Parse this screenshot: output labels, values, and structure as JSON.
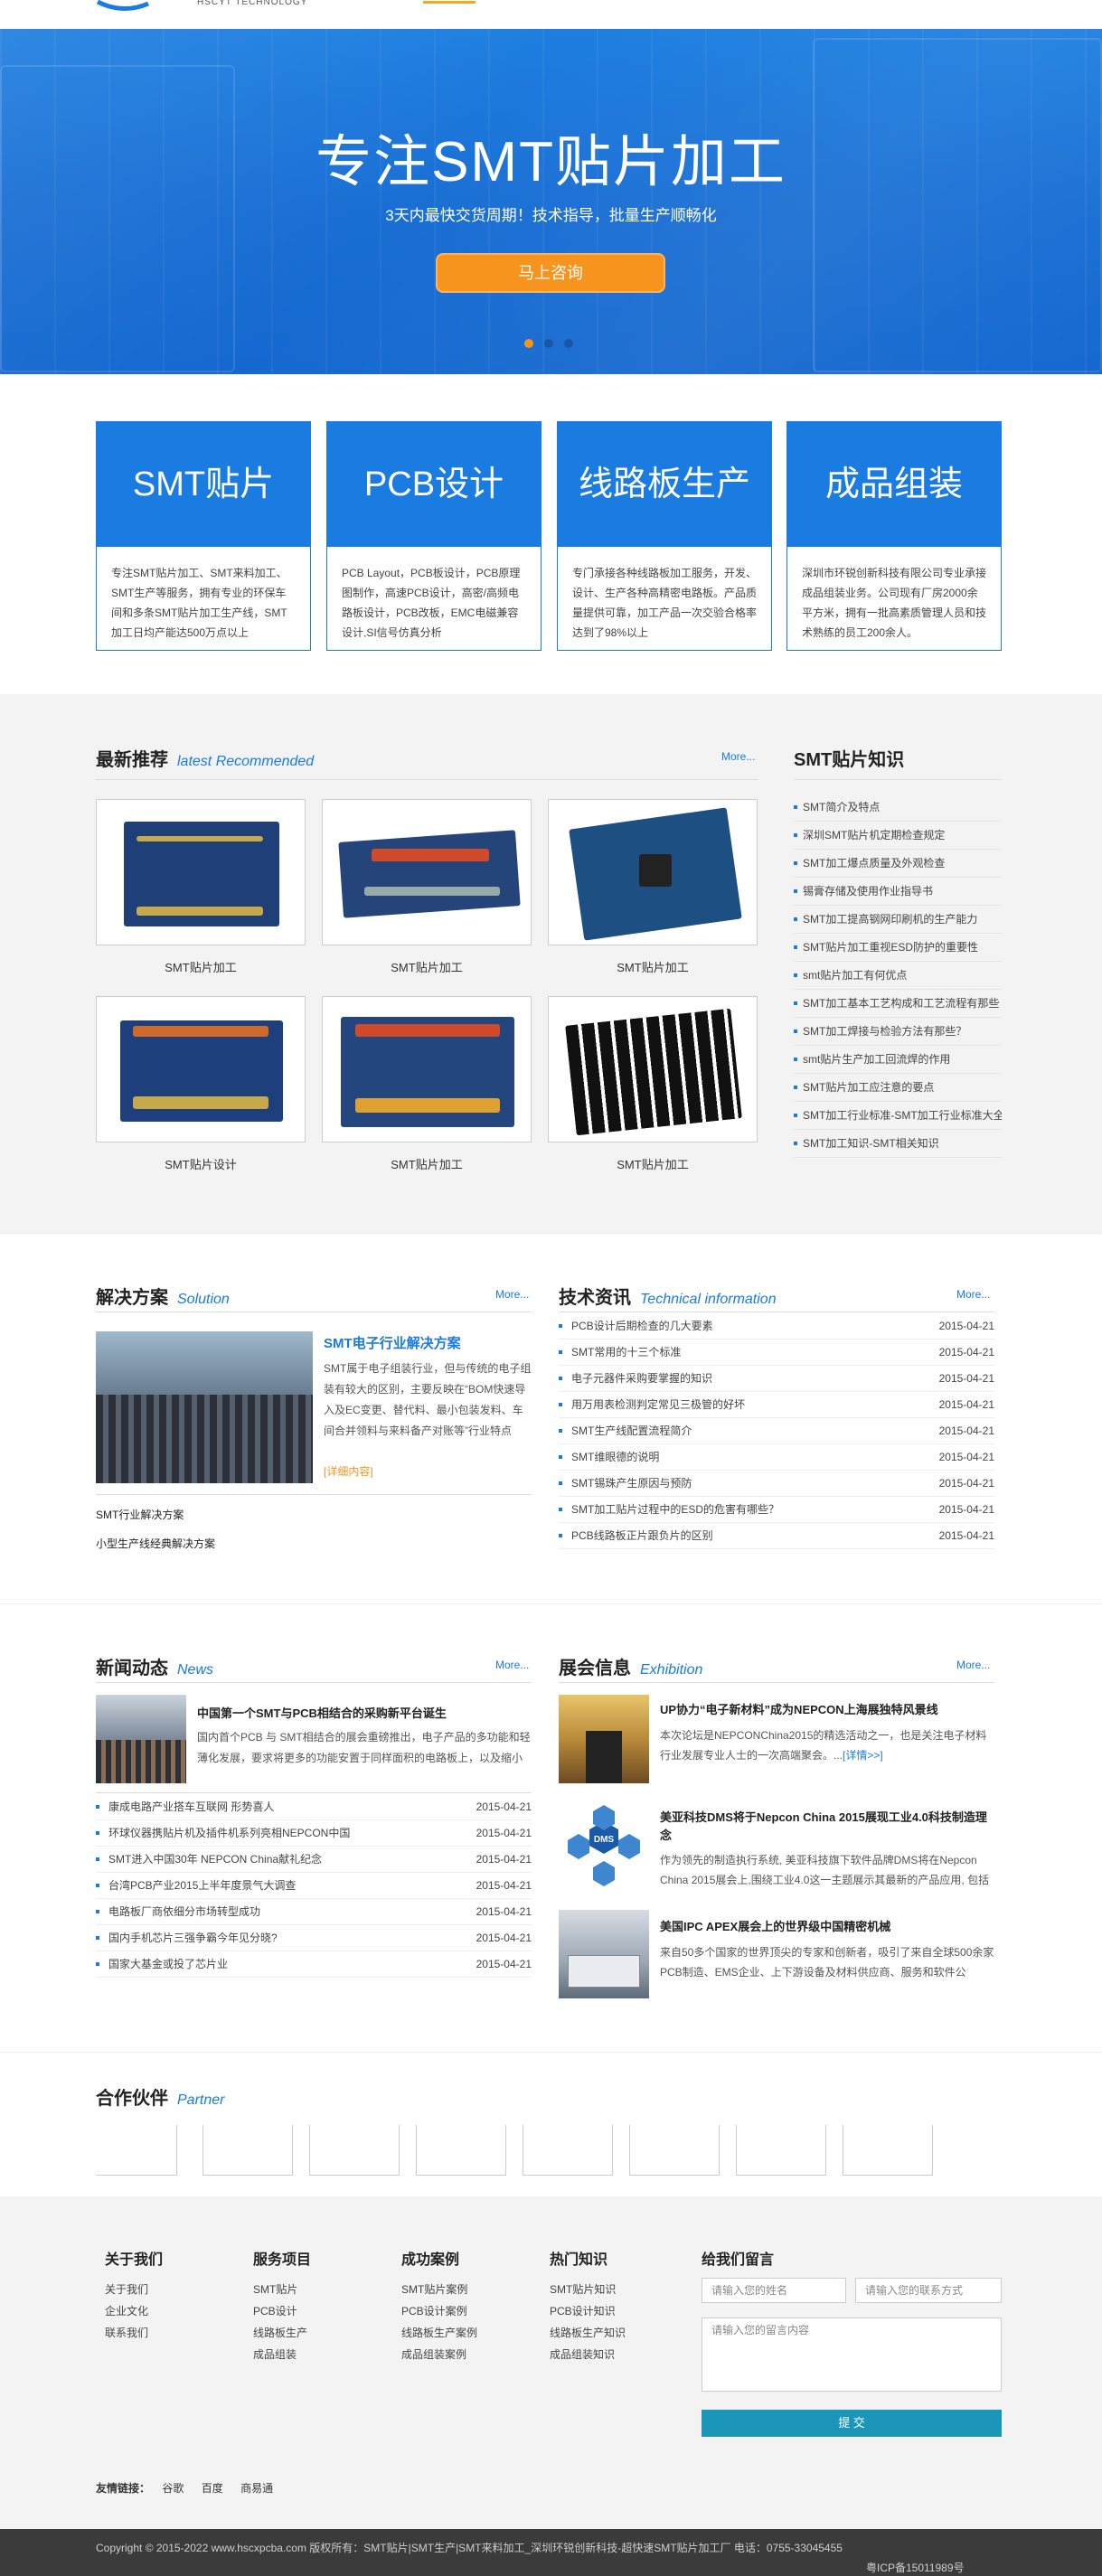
{
  "header": {
    "logo_text": "HSCYT TECHNOLOGY"
  },
  "hero": {
    "title": "专注SMT贴片加工",
    "subtitle": "3天内最快交货周期！技术指导，批量生产顺畅化",
    "cta_label": "马上咨询",
    "slide_count": 3,
    "active_slide": 1
  },
  "services": [
    {
      "title": "SMT贴片",
      "desc": "专注SMT贴片加工、SMT来料加工、SMT生产等服务，拥有专业的环保车间和多条SMT贴片加工生产线，SMT加工日均产能达500万点以上"
    },
    {
      "title": "PCB设计",
      "desc": "PCB Layout，PCB板设计，PCB原理图制作，高速PCB设计，高密/高频电路板设计，PCB改板，EMC电磁兼容设计,SI信号仿真分析"
    },
    {
      "title": "线路板生产",
      "desc": "专门承接各种线路板加工服务，开发、设计、生产各种高精密电路板。产品质量提供可靠，加工产品一次交验合格率达到了98%以上"
    },
    {
      "title": "成品组装",
      "desc": "深圳市环锐创新科技有限公司专业承接成品组装业务。公司现有厂房2000余平方米，拥有一批高素质管理人员和技术熟练的员工200余人。"
    }
  ],
  "recommend": {
    "title": "最新推荐",
    "title_en": "latest Recommended",
    "more": "More...",
    "products": [
      {
        "caption": "SMT贴片加工"
      },
      {
        "caption": "SMT贴片加工"
      },
      {
        "caption": "SMT贴片加工"
      },
      {
        "caption": "SMT贴片设计"
      },
      {
        "caption": "SMT贴片加工"
      },
      {
        "caption": "SMT贴片加工"
      }
    ]
  },
  "knowledge": {
    "title": "SMT贴片知识",
    "items": [
      "SMT简介及特点",
      "深圳SMT贴片机定期检查规定",
      "SMT加工爆点质量及外观检查",
      "锡膏存储及使用作业指导书",
      "SMT加工提高钢网印刷机的生产能力",
      "SMT贴片加工重视ESD防护的重要性",
      "smt贴片加工有何优点",
      "SMT加工基本工艺构成和工艺流程有那些",
      "SMT加工焊接与检验方法有那些？",
      "smt贴片生产加工回流焊的作用",
      "SMT贴片加工应注意的要点",
      "SMT加工行业标准-SMT加工行业标准大全",
      "SMT加工知识-SMT相关知识"
    ]
  },
  "solution": {
    "title": "解决方案",
    "title_en": "Solution",
    "more": "More...",
    "feature_title": "SMT电子行业解决方案",
    "feature_desc": "SMT属于电子组装行业，但与传统的电子组装有较大的区别，主要反映在“BOM快速导入及EC变更、替代料、最小包装发料、车间合并领料与来料备产对账等”行业特点",
    "detail_link": "[详细内容]",
    "links": [
      "SMT行业解决方案",
      "小型生产线经典解决方案"
    ]
  },
  "tech": {
    "title": "技术资讯",
    "title_en": "Technical information",
    "more": "More...",
    "items": [
      {
        "text": "PCB设计后期检查的几大要素",
        "date": "2015-04-21"
      },
      {
        "text": "SMT常用的十三个标准",
        "date": "2015-04-21"
      },
      {
        "text": "电子元器件采购要掌握的知识",
        "date": "2015-04-21"
      },
      {
        "text": "用万用表检测判定常见三极管的好坏",
        "date": "2015-04-21"
      },
      {
        "text": "SMT生产线配置流程简介",
        "date": "2015-04-21"
      },
      {
        "text": "SMT维眼德的说明",
        "date": "2015-04-21"
      },
      {
        "text": "SMT锡珠产生原因与预防",
        "date": "2015-04-21"
      },
      {
        "text": "SMT加工贴片过程中的ESD的危害有哪些？",
        "date": "2015-04-21"
      },
      {
        "text": "PCB线路板正片跟负片的区别",
        "date": "2015-04-21"
      }
    ]
  },
  "news": {
    "title": "新闻动态",
    "title_en": "News",
    "more": "More...",
    "feature_title": "中国第一个SMT与PCB相结合的采购新平台诞生",
    "feature_desc": "国内首个PCB 与 SMT相结合的展会重磅推出，电子产品的多功能和轻薄化发展，要求将更多的功能安置于同样面积的电路板上，以及缩小",
    "items": [
      {
        "text": "康成电路产业搭车互联网 形势喜人",
        "date": "2015-04-21"
      },
      {
        "text": "环球仪器携贴片机及插件机系列亮相NEPCON中国",
        "date": "2015-04-21"
      },
      {
        "text": "SMT进入中国30年 NEPCON China献礼纪念",
        "date": "2015-04-21"
      },
      {
        "text": "台湾PCB产业2015上半年度景气大调查",
        "date": "2015-04-21"
      },
      {
        "text": "电路板厂商依细分市场转型成功",
        "date": "2015-04-21"
      },
      {
        "text": "国内手机芯片三强争霸今年见分晓?",
        "date": "2015-04-21"
      },
      {
        "text": "国家大基金或投了芯片业",
        "date": "2015-04-21"
      }
    ]
  },
  "exhibition": {
    "title": "展会信息",
    "title_en": "Exhibition",
    "more": "More...",
    "items": [
      {
        "title": "UP协力“电子新材料”成为NEPCON上海展独特风景线",
        "desc": "本次论坛是NEPCONChina2015的精选活动之一，也是关注电子材料行业发展专业人士的一次高端聚会。...",
        "link": "[详情>>]"
      },
      {
        "title": "美亚科技DMS将于Nepcon China 2015展现工业4.0科技制造理念",
        "desc": "作为领先的制造执行系统, 美亚科技旗下软件品牌DMS将在Nepcon China 2015展会上,围绕工业4.0这一主题展示其最新的产品应用, 包括"
      },
      {
        "title": "美国IPC APEX展会上的世界级中国精密机械",
        "desc": "来自50多个国家的世界顶尖的专家和创新者，吸引了来自全球500余家PCB制造、EMS企业、上下游设备及材料供应商、服务和软件公"
      }
    ]
  },
  "partners": {
    "title": "合作伙伴",
    "title_en": "Partner",
    "count": 8
  },
  "footer": {
    "columns": [
      {
        "title": "关于我们",
        "items": [
          "关于我们",
          "企业文化",
          "联系我们"
        ]
      },
      {
        "title": "服务项目",
        "items": [
          "SMT贴片",
          "PCB设计",
          "线路板生产",
          "成品组装"
        ]
      },
      {
        "title": "成功案例",
        "items": [
          "SMT贴片案例",
          "PCB设计案例",
          "线路板生产案例",
          "成品组装案例"
        ]
      },
      {
        "title": "热门知识",
        "items": [
          "SMT贴片知识",
          "PCB设计知识",
          "线路板生产知识",
          "成品组装知识"
        ]
      }
    ],
    "message": {
      "title": "给我们留言",
      "name_placeholder": "请输入您的姓名",
      "contact_placeholder": "请输入您的联系方式",
      "content_placeholder": "请输入您的留言内容",
      "submit_label": "提 交"
    },
    "links_label": "友情链接：",
    "links": [
      "谷歌",
      "百度",
      "商易通"
    ],
    "copyright": "Copyright © 2015-2022 www.hscxpcba.com 版权所有：SMT贴片|SMT生产|SMT来料加工_深圳环锐创新科技-超快速SMT贴片加工厂 电话：0755-33045455",
    "icp": "粤ICP备15011989号"
  },
  "colors": {
    "brand_blue": "#1a7be0",
    "cta_orange": "#f7941d",
    "submit_teal": "#1b96b8",
    "footer_bar": "#3b3b3b"
  }
}
